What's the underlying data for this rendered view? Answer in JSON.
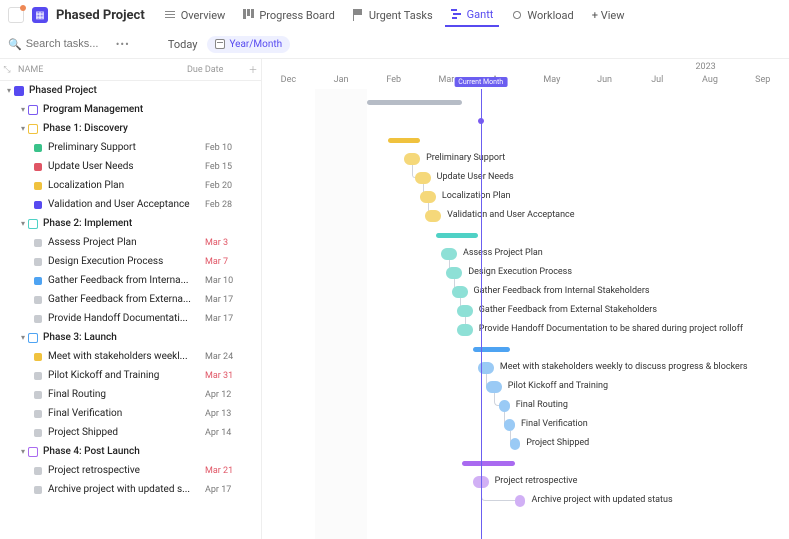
{
  "header": {
    "title": "Phased Project",
    "tabs": [
      {
        "id": "overview",
        "label": "Overview",
        "icon": "list"
      },
      {
        "id": "progress",
        "label": "Progress Board",
        "icon": "board"
      },
      {
        "id": "urgent",
        "label": "Urgent Tasks",
        "icon": "flag"
      },
      {
        "id": "gantt",
        "label": "Gantt",
        "icon": "gantt",
        "active": true
      },
      {
        "id": "workload",
        "label": "Workload",
        "icon": "work"
      },
      {
        "id": "addview",
        "label": "+ View",
        "icon": ""
      }
    ]
  },
  "toolbar": {
    "search_placeholder": "Search tasks...",
    "today_label": "Today",
    "range_label": "Year/Month"
  },
  "columns": {
    "name": "NAME",
    "due": "Due Date"
  },
  "timeline": {
    "year": "2023",
    "months": [
      "Dec",
      "Jan",
      "Feb",
      "Mar",
      "Apr",
      "May",
      "Jun",
      "Jul",
      "Aug",
      "Sep"
    ],
    "current_badge": "Current Month",
    "today_x_pct": 41.5
  },
  "colors": {
    "grey": "#b6bcc6",
    "purple": "#7a5af0",
    "yellow": "#f0c23e",
    "green": "#f0c23e",
    "teal": "#4fd1c5",
    "blue": "#4ea3f2",
    "violet": "#a96af0",
    "pink": "#e879c7",
    "red": "#e05565"
  },
  "tree": [
    {
      "type": "root",
      "name": "Phased Project",
      "bar_color": "#b6bcc6",
      "bar": {
        "x": 20,
        "w": 18
      }
    },
    {
      "type": "section",
      "name": "Program Management",
      "bar_color": "#7a5af0",
      "diamond": {
        "x": 41.0
      }
    },
    {
      "type": "section",
      "name": "Phase 1: Discovery",
      "bar_color": "#f0c23e",
      "bar": {
        "x": 24,
        "w": 6
      }
    },
    {
      "type": "task",
      "name": "Preliminary Support",
      "due": "Feb 10",
      "bullet": "#3ac28a",
      "pill": {
        "x": 27,
        "w": 3,
        "c": "#f5d87a"
      }
    },
    {
      "type": "task",
      "name": "Update User Needs",
      "due": "Feb 15",
      "bullet": "#e05565",
      "pill": {
        "x": 29,
        "w": 3,
        "c": "#f5d87a"
      }
    },
    {
      "type": "task",
      "name": "Localization Plan",
      "due": "Feb 20",
      "bullet": "#f0c23e",
      "pill": {
        "x": 30,
        "w": 3,
        "c": "#f5d87a"
      }
    },
    {
      "type": "task",
      "name": "Validation and User Acceptance",
      "due": "Feb 28",
      "bullet": "#574af0",
      "pill": {
        "x": 31,
        "w": 3,
        "c": "#f5d87a"
      }
    },
    {
      "type": "section",
      "name": "Phase 2: Implement",
      "bar_color": "#4fd1c5",
      "bar": {
        "x": 33,
        "w": 8
      }
    },
    {
      "type": "task",
      "name": "Assess Project Plan",
      "due": "Mar 3",
      "due_red": true,
      "bullet": "#c8cbd0",
      "pill": {
        "x": 34,
        "w": 3,
        "c": "#8ee0d6"
      }
    },
    {
      "type": "task",
      "name": "Design Execution Process",
      "due": "Mar 7",
      "due_red": true,
      "bullet": "#c8cbd0",
      "pill": {
        "x": 35,
        "w": 3,
        "c": "#8ee0d6"
      }
    },
    {
      "type": "task",
      "name": "Gather Feedback from Internal Stakeholders",
      "short": "Gather Feedback from Interna...",
      "due": "Mar 10",
      "bullet": "#4ea3f2",
      "pill": {
        "x": 36,
        "w": 3,
        "c": "#8ee0d6"
      }
    },
    {
      "type": "task",
      "name": "Gather Feedback from External Stakeholders",
      "short": "Gather Feedback from Externa...",
      "due": "Mar 17",
      "bullet": "#c8cbd0",
      "pill": {
        "x": 37,
        "w": 3,
        "c": "#8ee0d6"
      }
    },
    {
      "type": "task",
      "name": "Provide Handoff Documentation to be shared during project rolloff",
      "short": "Provide Handoff Documentati...",
      "due": "Mar 17",
      "bullet": "#c8cbd0",
      "pill": {
        "x": 37,
        "w": 3,
        "c": "#8ee0d6"
      }
    },
    {
      "type": "section",
      "name": "Phase 3: Launch",
      "bar_color": "#4ea3f2",
      "bar": {
        "x": 40,
        "w": 7
      }
    },
    {
      "type": "task",
      "name": "Meet with stakeholders weekly to discuss progress & blockers",
      "short": "Meet with stakeholders weekl...",
      "due": "Mar 24",
      "bullet": "#f0c23e",
      "pill": {
        "x": 41,
        "w": 3,
        "c": "#9acaf5"
      }
    },
    {
      "type": "task",
      "name": "Pilot Kickoff and Training",
      "due": "Mar 31",
      "due_red": true,
      "bullet": "#c8cbd0",
      "pill": {
        "x": 42.5,
        "w": 3,
        "c": "#9acaf5"
      }
    },
    {
      "type": "task",
      "name": "Final Routing",
      "due": "Apr 12",
      "bullet": "#c8cbd0",
      "pill": {
        "x": 45,
        "w": 2,
        "c": "#9acaf5"
      }
    },
    {
      "type": "task",
      "name": "Final Verification",
      "due": "Apr 13",
      "bullet": "#c8cbd0",
      "pill": {
        "x": 46,
        "w": 2,
        "c": "#9acaf5"
      }
    },
    {
      "type": "task",
      "name": "Project Shipped",
      "due": "Apr 14",
      "bullet": "#c8cbd0",
      "pill": {
        "x": 47,
        "w": 2,
        "c": "#9acaf5"
      }
    },
    {
      "type": "section",
      "name": "Phase 4: Post Launch",
      "bar_color": "#a96af0",
      "bar": {
        "x": 38,
        "w": 10
      }
    },
    {
      "type": "task",
      "name": "Project retrospective",
      "due": "Mar 21",
      "due_red": true,
      "bullet": "#c8cbd0",
      "pill": {
        "x": 40,
        "w": 3,
        "c": "#d1b0f5"
      }
    },
    {
      "type": "task",
      "name": "Archive project with updated status",
      "short": "Archive project with updated s...",
      "due": "Apr 17",
      "bullet": "#c8cbd0",
      "pill": {
        "x": 48,
        "w": 2,
        "c": "#d1b0f5"
      }
    }
  ]
}
